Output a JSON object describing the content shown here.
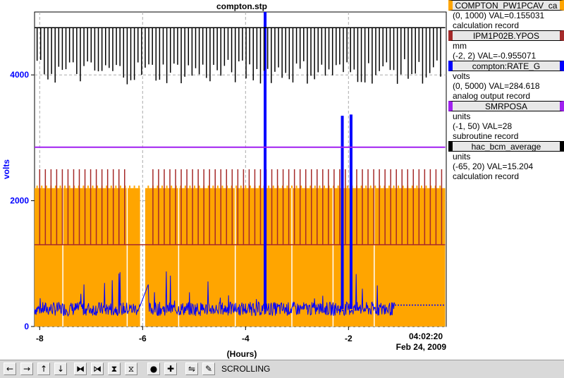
{
  "chart_data": {
    "type": "line",
    "title": "compton.stp",
    "xlabel": "(Hours)",
    "ylabel": "volts",
    "xlim": [
      -8.1,
      -0.1
    ],
    "ylim": [
      0,
      5000
    ],
    "x_ticks": [
      "-8",
      "-6",
      "-4",
      "-2"
    ],
    "y_ticks": [
      "0",
      "2000",
      "4000"
    ],
    "end_time": "04:02:20",
    "end_date": "Feb 24, 2009",
    "grid": true,
    "series": [
      {
        "name": "COMPTON_PW1PCAV_ca",
        "color": "#ffa500",
        "range": "(0, 1000)",
        "val": "VAL=0.155031",
        "units": "",
        "desc": "calculation record",
        "baseline": 2200,
        "spike_low": 0,
        "note_values": [
          2200,
          1200,
          0
        ]
      },
      {
        "name": "IPM1P02B.YPOS",
        "color": "#a52a2a",
        "range": "(-2, 2)",
        "val": "VAL=-0.955071",
        "units": "mm",
        "desc": "",
        "baseline": 1300,
        "spike_high": 2500
      },
      {
        "name": "compton:RATE_G",
        "color": "#0000ff",
        "range": "(0, 5000)",
        "val": "VAL=284.618",
        "units": "volts",
        "desc": "analog output record",
        "baseline": 280,
        "spikes": [
          [
            -3.62,
            5000
          ],
          [
            -2.12,
            3350
          ],
          [
            -1.95,
            3370
          ]
        ]
      },
      {
        "name": "SMRPOSA",
        "color": "#a020f0",
        "range": "(-1, 50)",
        "val": "VAL=28",
        "units": "units",
        "desc": "subroutine record",
        "baseline": 2850
      },
      {
        "name": "hac_bcm_average",
        "color": "#000000",
        "range": "(-65, 20)",
        "val": "VAL=15.204",
        "units": "units",
        "desc": "calculation record",
        "baseline": 4750,
        "dip": 3850
      }
    ]
  },
  "toolbar": {
    "status": "SCROLLING",
    "buttons": [
      "arrow-left-icon",
      "arrow-right-icon",
      "arrow-up-icon",
      "arrow-down-icon",
      "zoom-in-horizontal-icon",
      "zoom-out-horizontal-icon",
      "zoom-in-vertical-icon",
      "zoom-out-vertical-icon",
      "auto-scale-icon",
      "add-icon",
      "auto-scale-horizontal-icon",
      "config-icon"
    ],
    "glyphs": [
      "←",
      "→",
      "↑",
      "↓",
      "⧓",
      "⧒",
      "⧗",
      "⧖",
      "●",
      "✚",
      "⇋",
      "✎"
    ]
  }
}
